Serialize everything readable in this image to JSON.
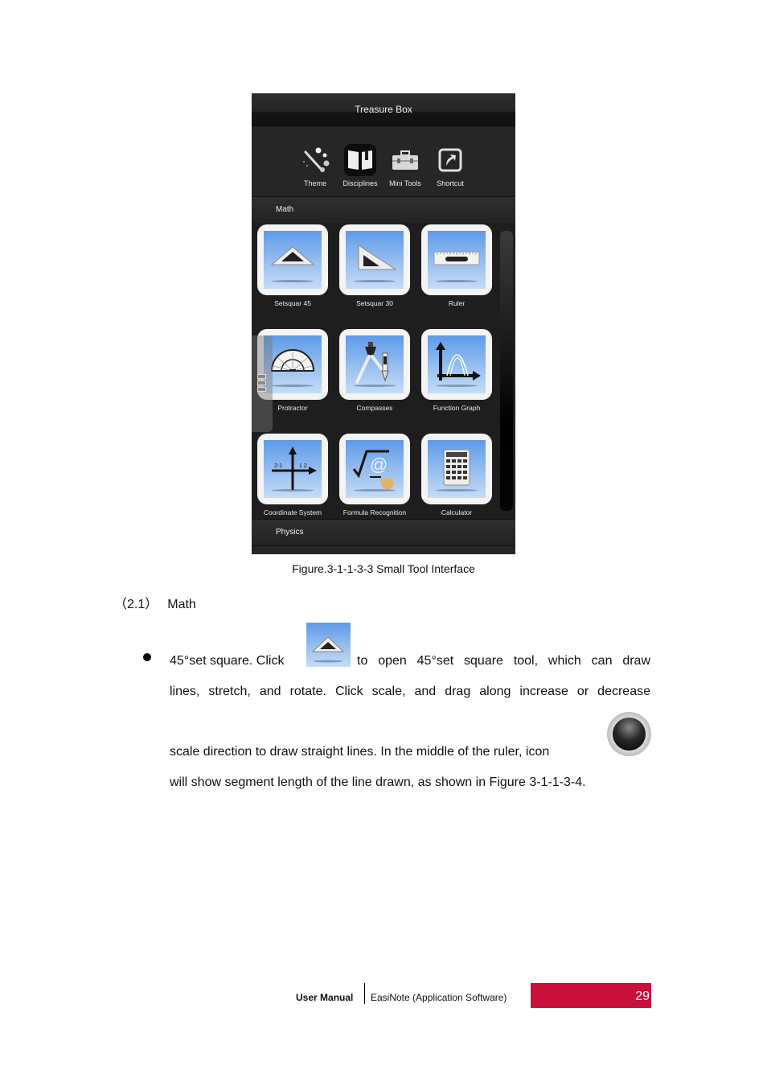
{
  "panel": {
    "title": "Treasure Box",
    "tabs": [
      {
        "label": "Theme",
        "icon": "theme-wand-icon",
        "active": false
      },
      {
        "label": "Disciplines",
        "icon": "book-icon",
        "active": true
      },
      {
        "label": "Mini Tools",
        "icon": "toolbox-icon",
        "active": false
      },
      {
        "label": "Shortcut",
        "icon": "shortcut-arrow-icon",
        "active": false
      }
    ],
    "sections": [
      {
        "label": "Math"
      },
      {
        "label": "Physics"
      }
    ],
    "tools": [
      {
        "label": "Setsquar 45",
        "icon": "setsquare-45-icon"
      },
      {
        "label": "Setsquar 30",
        "icon": "setsquare-30-icon"
      },
      {
        "label": "Ruler",
        "icon": "ruler-icon"
      },
      {
        "label": "Protractor",
        "icon": "protractor-icon"
      },
      {
        "label": "Compasses",
        "icon": "compasses-icon"
      },
      {
        "label": "Function Graph",
        "icon": "function-graph-icon"
      },
      {
        "label": "Coordinate System",
        "icon": "coordinate-system-icon"
      },
      {
        "label": "Formula Recognition",
        "icon": "formula-recognition-icon"
      },
      {
        "label": "Calculator",
        "icon": "calculator-icon"
      }
    ]
  },
  "document": {
    "caption": "Figure.3-1-1-3-3 Small Tool Interface",
    "heading_num": "（2.1）",
    "heading_text": "Math",
    "line1_before": "45°set square. Click",
    "line1_after": "to open 45°set square tool, which can draw",
    "line2": "lines, stretch, and rotate. Click scale, and drag along increase or decrease",
    "line3": "scale direction to draw straight lines. In the middle of the ruler, icon",
    "line4": "will show segment length of the line drawn, as shown in Figure 3-1-1-3-4."
  },
  "footer": {
    "manual": "User Manual",
    "product": "EasiNote (Application Software)",
    "page": "29",
    "accent": "#c8103b"
  }
}
